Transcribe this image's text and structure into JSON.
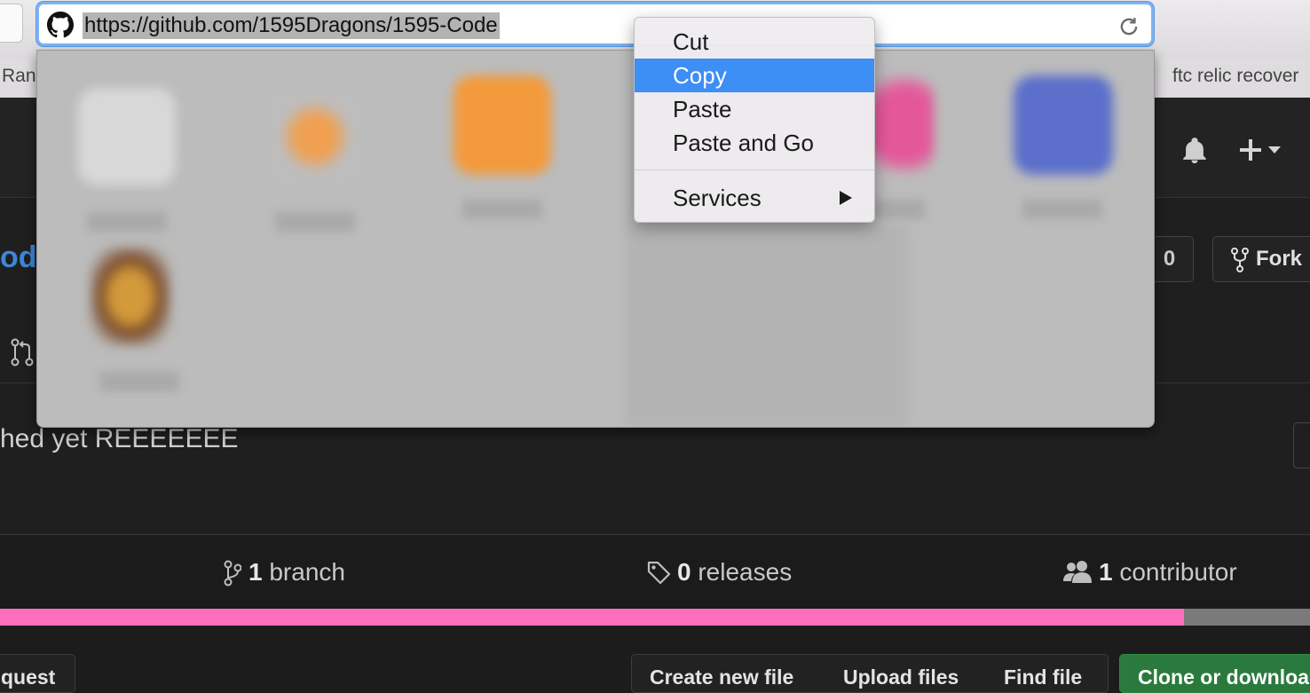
{
  "browser": {
    "url": "https://github.com/1595Dragons/1595-Code",
    "site_icon": "github-icon",
    "reload_icon": "reload-icon"
  },
  "bookmarks": {
    "left_fragment": "Ran",
    "right_fragment": "ftc relic recover"
  },
  "context_menu": {
    "items": [
      {
        "label": "Cut",
        "highlighted": false
      },
      {
        "label": "Copy",
        "highlighted": true
      },
      {
        "label": "Paste",
        "highlighted": false
      },
      {
        "label": "Paste and Go",
        "highlighted": false
      }
    ],
    "services_label": "Services",
    "highlight_color": "#3d8ef5"
  },
  "github": {
    "header": {
      "notification_icon": "bell-icon",
      "create_icon": "plus-icon"
    },
    "repo": {
      "name_fragment": "od",
      "watch_count": "0",
      "fork_label": "Fork"
    },
    "description": "hed yet REEEEEEE",
    "summary": {
      "branches": {
        "count": "1",
        "label": "branch"
      },
      "releases": {
        "count": "0",
        "label": "releases"
      },
      "contributors": {
        "count": "1",
        "label": "contributor"
      }
    },
    "language_bar": {
      "primary_color": "#ff6fbc",
      "primary_fraction": 0.904
    },
    "actions": {
      "pull_request": "quest",
      "create_file": "Create new file",
      "upload_files": "Upload files",
      "find_file": "Find file",
      "clone": "Clone or download"
    }
  }
}
